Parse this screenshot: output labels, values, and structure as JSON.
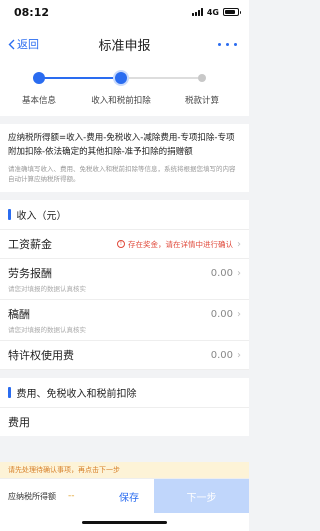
{
  "status_bar": {
    "time": "08:12",
    "network": "4G"
  },
  "nav": {
    "back_label": "返回",
    "title": "标准申报"
  },
  "steps": {
    "items": [
      {
        "label": "基本信息",
        "state": "done"
      },
      {
        "label": "收入和税前扣除",
        "state": "current"
      },
      {
        "label": "税款计算",
        "state": "pending"
      }
    ]
  },
  "formula": {
    "main": "应纳税所得额=收入-费用-免税收入-减除费用-专项扣除-专项附加扣除-依法确定的其他扣除-准予扣除的捐赠额",
    "note": "请准确填写收入、费用、免税收入和税前扣除等信息，系统将根据您填写的内容自动计算应纳税所得额。"
  },
  "income_section": {
    "title": "收入（元）",
    "rows": [
      {
        "label": "工资薪金",
        "warning": "存在奖金，请在详情中进行确认",
        "value": "",
        "hint": ""
      },
      {
        "label": "劳务报酬",
        "warning": "",
        "value": "0.00",
        "hint": "请您对填报的数据认真核实"
      },
      {
        "label": "稿酬",
        "warning": "",
        "value": "0.00",
        "hint": "请您对填报的数据认真核实"
      },
      {
        "label": "特许权使用费",
        "warning": "",
        "value": "0.00",
        "hint": ""
      }
    ]
  },
  "deduction_section": {
    "title": "费用、免税收入和税前扣除",
    "rows": [
      {
        "label": "费用"
      }
    ]
  },
  "warning_banner": "请先处理待确认事项，再点击下一步",
  "bottom": {
    "tax_label": "应纳税所得额",
    "tax_value": "--",
    "save_label": "保存",
    "next_label": "下一步"
  },
  "colors": {
    "accent": "#2a6cf0",
    "warning": "#e0493a",
    "pending": "#c8c8c8"
  }
}
